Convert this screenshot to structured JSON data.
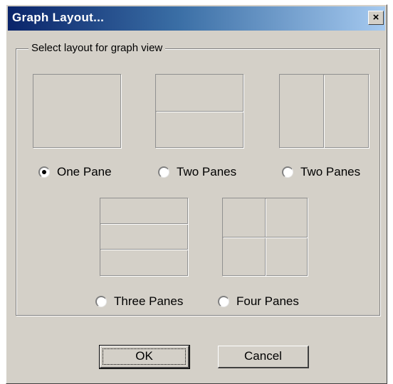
{
  "window": {
    "title": "Graph Layout...",
    "close_symbol": "×"
  },
  "group": {
    "legend": "Select layout for graph view"
  },
  "options": [
    {
      "label": "One Pane",
      "checked": true,
      "icon": "one-pane-layout-icon"
    },
    {
      "label": "Two Panes",
      "checked": false,
      "icon": "two-panes-horizontal-icon"
    },
    {
      "label": "Two Panes",
      "checked": false,
      "icon": "two-panes-vertical-icon"
    },
    {
      "label": "Three Panes",
      "checked": false,
      "icon": "three-panes-horizontal-icon"
    },
    {
      "label": "Four Panes",
      "checked": false,
      "icon": "four-panes-grid-icon"
    }
  ],
  "buttons": {
    "ok": "OK",
    "cancel": "Cancel"
  },
  "colors": {
    "face": "#d4d0c8",
    "title_start": "#0a246a",
    "title_end": "#a6caf0"
  }
}
